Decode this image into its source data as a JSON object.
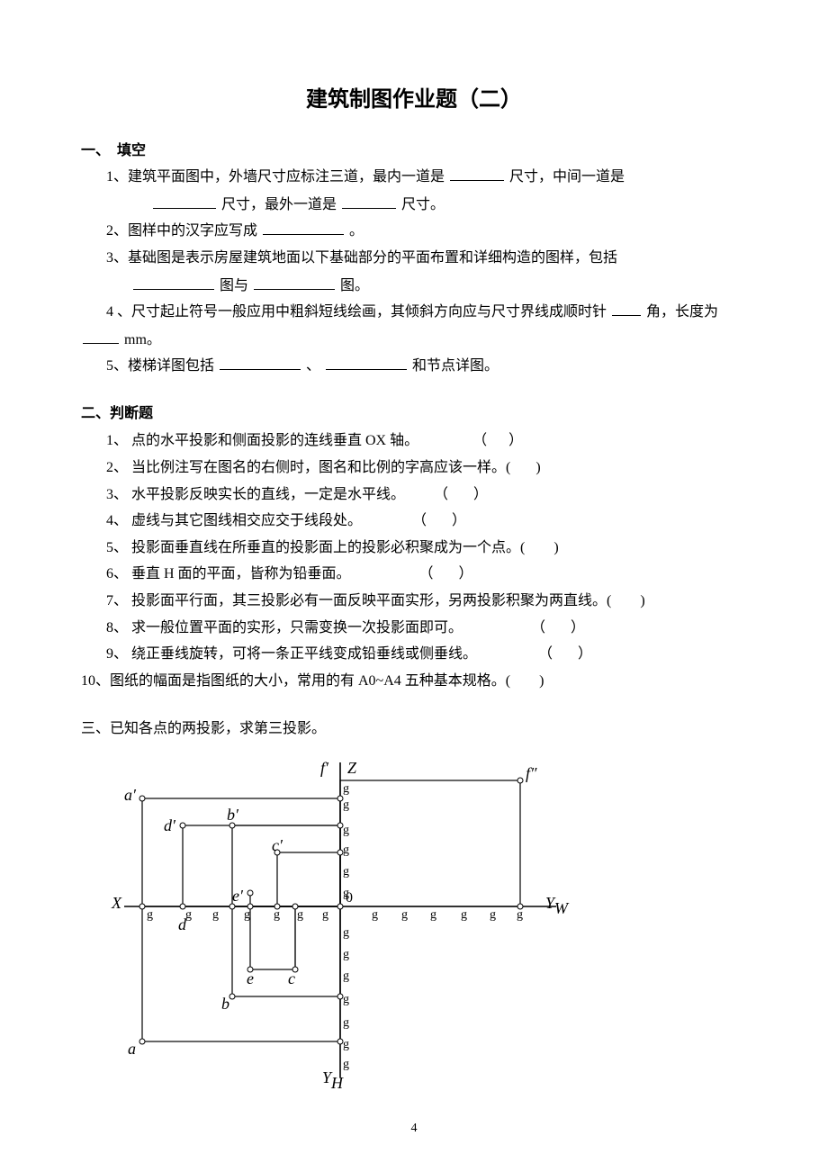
{
  "title": "建筑制图作业题（二）",
  "section1": {
    "header": "一、　填空",
    "q1_a": "1、建筑平面图中，外墙尺寸应标注三道，最内一道是",
    "q1_b": "尺寸，中间一道是",
    "q1_c": "尺寸，最外一道是",
    "q1_d": " 尺寸。",
    "q2_a": "2、图样中的汉字应写成",
    "q2_b": "。",
    "q3_a": "3、基础图是表示房屋建筑地面以下基础部分的平面布置和详细构造的图样，包括",
    "q3_b": "图与",
    "q3_c": "图。",
    "q4_a": "4 、尺寸起止符号一般应用中粗斜短线绘画，其倾斜方向应与尺寸界线成顺时针",
    "q4_b": " 角，长度为",
    "q4_c": "mm。",
    "q5_a": "5、楼梯详图包括",
    "q5_b": "、",
    "q5_c": "和节点详图。"
  },
  "section2": {
    "header": "二、判断题",
    "items": [
      "1、 点的水平投影和侧面投影的连线垂直 OX 轴。               （      ）",
      "2、 当比例注写在图名的右侧时，图名和比例的字高应该一样。(       )",
      "3、 水平投影反映实长的直线，一定是水平线。        （       ）",
      "4、 虚线与其它图线相交应交于线段处。              （       ）",
      "5、 投影面垂直线在所垂直的投影面上的投影必积聚成为一个点。(        )",
      "6、 垂直 H 面的平面，皆称为铅垂面。                   （       ）",
      "7、 投影面平行面，其三投影必有一面反映平面实形，另两投影积聚为两直线。(        )",
      "8、 求一般位置平面的实形，只需变换一次投影面即可。                   （       ）",
      "9、 绕正垂线旋转，可将一条正平线变成铅垂线或侧垂线。                 （       ）"
    ],
    "item10": "10、图纸的幅面是指图纸的大小，常用的有 A0~A4 五种基本规格。(        )"
  },
  "section3": {
    "header": "三、已知各点的两投影，求第三投影。"
  },
  "diagram": {
    "axes": {
      "Z": "Z",
      "X": "X",
      "YW": "Y",
      "YW_sub": "W",
      "YH": "Y",
      "YH_sub": "H",
      "origin": "0"
    },
    "points": {
      "f_prime": "f′",
      "f_dprime": "f″",
      "a_prime": "a′",
      "d_prime": "d′",
      "b_prime": "b′",
      "c_prime": "c′",
      "e_prime": "e′",
      "d": "d",
      "e": "e",
      "c": "c",
      "b": "b",
      "a": "a"
    },
    "tick_char": "g"
  },
  "page_number": "4"
}
